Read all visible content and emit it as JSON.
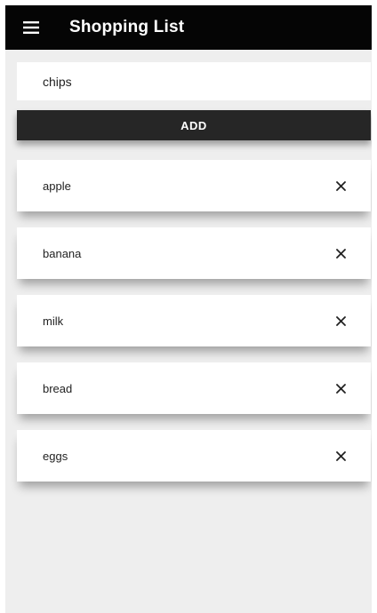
{
  "app_bar": {
    "title": "Shopping List",
    "menu_icon": "hamburger-menu-icon",
    "background": "#050505"
  },
  "add_form": {
    "input_value": "chips",
    "add_label": "ADD"
  },
  "items": [
    {
      "label": "apple",
      "remove_icon": "close-icon"
    },
    {
      "label": "banana",
      "remove_icon": "close-icon"
    },
    {
      "label": "milk",
      "remove_icon": "close-icon"
    },
    {
      "label": "bread",
      "remove_icon": "close-icon"
    },
    {
      "label": "eggs",
      "remove_icon": "close-icon"
    }
  ],
  "colors": {
    "screen_background": "#eeeeee",
    "button_background": "#262626",
    "card_background": "#ffffff"
  }
}
